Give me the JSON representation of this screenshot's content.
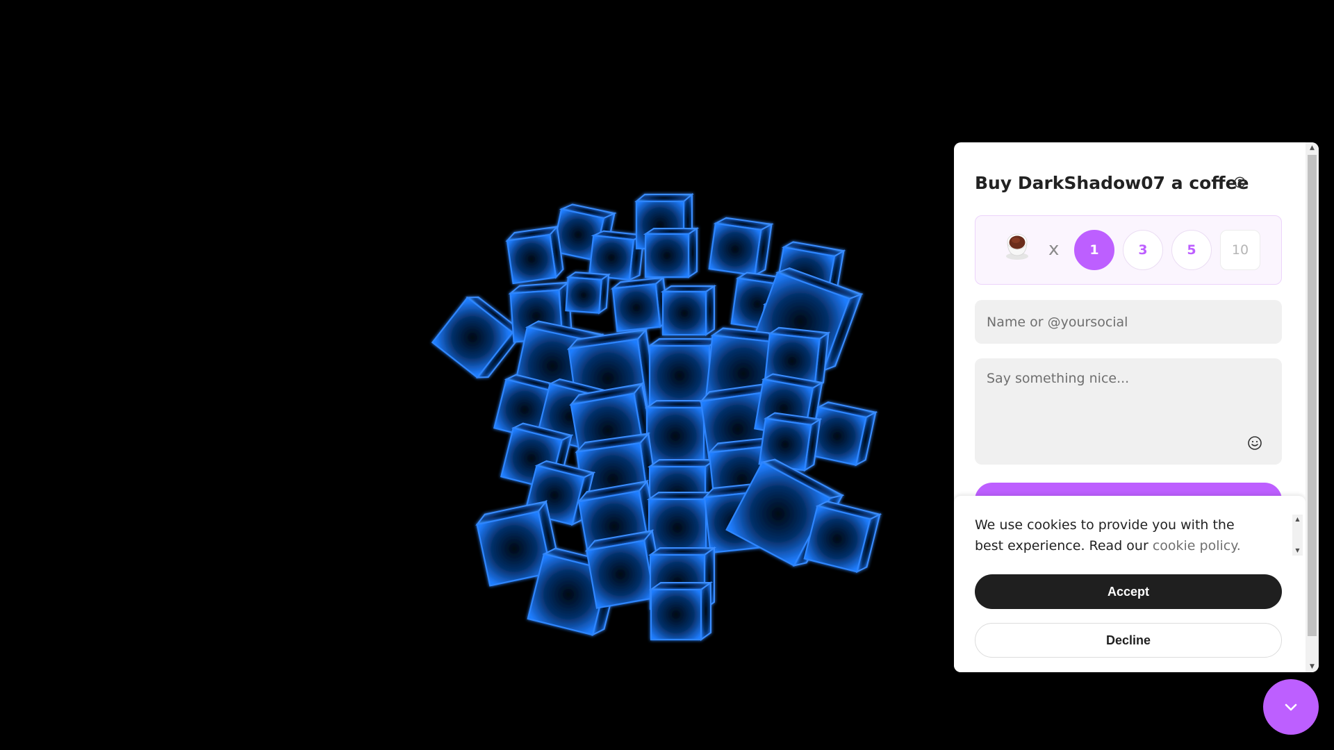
{
  "widget": {
    "title": "Buy DarkShadow07 a coffee",
    "help_icon": "question-circle-icon",
    "multiplier": "x",
    "quantities": [
      "1",
      "3",
      "5",
      "10"
    ],
    "selected_quantity": "1",
    "cup_icon": "coffee-cup-icon",
    "name_placeholder": "Name or @yoursocial",
    "message_placeholder": "Say something nice...",
    "emoji_icon": "smiley-icon",
    "accent_color": "#bd5fff"
  },
  "cookie": {
    "text": "We use cookies to provide you with the best experience. Read our ",
    "link_text": "cookie policy.",
    "accept_label": "Accept",
    "decline_label": "Decline"
  },
  "toggle": {
    "icon": "chevron-down-icon"
  },
  "background": {
    "art": "blue-glowing-cube-cluster"
  }
}
